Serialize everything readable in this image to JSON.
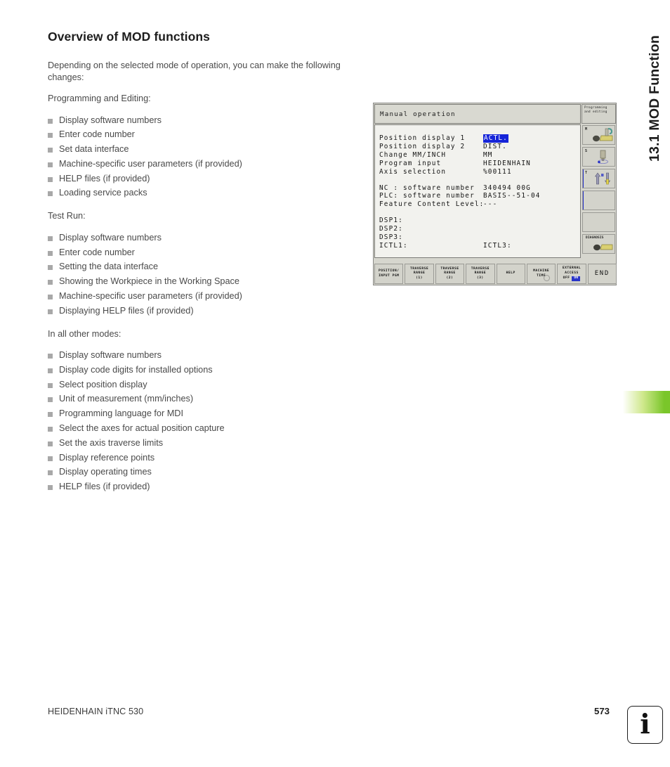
{
  "chapter_title": "13.1 MOD Function",
  "heading": "Overview of MOD functions",
  "intro": "Depending on the selected mode of operation, you can make the following changes:",
  "sections": [
    {
      "label": "Programming and Editing:",
      "items": [
        "Display software numbers",
        "Enter code number",
        "Set data interface",
        "Machine-specific user parameters (if provided)",
        "HELP files (if provided)",
        "Loading service packs"
      ]
    },
    {
      "label": "Test Run:",
      "items": [
        "Display software numbers",
        "Enter code number",
        "Setting the data interface",
        "Showing the Workpiece in the Working Space",
        "Machine-specific user parameters (if provided)",
        "Displaying HELP files (if provided)"
      ]
    },
    {
      "label": "In all other modes:",
      "items": [
        "Display software numbers",
        "Display code digits for installed options",
        "Select position display",
        "Unit of measurement (mm/inches)",
        "Programming language for MDI",
        "Select the axes for actual position capture",
        "Set the axis traverse limits",
        "Display reference points",
        "Display operating times",
        "HELP files (if provided)"
      ]
    }
  ],
  "cnc": {
    "mode_title": "Manual operation",
    "mode_box_line1": "Programming",
    "mode_box_line2": "and editing",
    "settings": [
      {
        "label": "Position display 1",
        "value": "ACTL.",
        "highlighted": true
      },
      {
        "label": "Position display 2",
        "value": "DIST.",
        "highlighted": false
      },
      {
        "label": "Change MM/INCH",
        "value": "MM",
        "highlighted": false
      },
      {
        "label": "Program input",
        "value": "HEIDENHAIN",
        "highlighted": false
      },
      {
        "label": "Axis selection",
        "value": "%00111",
        "highlighted": false
      }
    ],
    "versions": [
      {
        "label": "NC : software number",
        "value": "340494 00G"
      },
      {
        "label": "PLC: software number",
        "value": "BASIS--51-04"
      },
      {
        "label": "Feature Content Level:",
        "value": "---"
      }
    ],
    "diagnostics": [
      {
        "label": "DSP1:",
        "value": ""
      },
      {
        "label": "DSP2:",
        "value": ""
      },
      {
        "label": "DSP3:",
        "value": ""
      },
      {
        "label": "ICTL1:",
        "value": "ICTL3:"
      }
    ],
    "vertical_keys": [
      {
        "key": "M",
        "icon": "spindle-m-icon"
      },
      {
        "key": "S",
        "icon": "spindle-s-icon"
      },
      {
        "key": "T",
        "icon": "tool-change-icon"
      },
      {
        "key": "",
        "icon": ""
      },
      {
        "key": "",
        "icon": ""
      },
      {
        "key": "DIAGNOSIS",
        "icon": "diagnosis-icon"
      }
    ],
    "softkeys": [
      {
        "line1": "POSITION/",
        "line2": "INPUT PGM",
        "line3": ""
      },
      {
        "line1": "TRAVERSE",
        "line2": "RANGE",
        "line3": "(1)"
      },
      {
        "line1": "TRAVERSE",
        "line2": "RANGE",
        "line3": "(2)"
      },
      {
        "line1": "TRAVERSE",
        "line2": "RANGE",
        "line3": "(3)"
      },
      {
        "line1": "HELP",
        "line2": "",
        "line3": ""
      },
      {
        "line1": "MACHINE",
        "line2": "TIME",
        "line3": ""
      },
      {
        "line1": "EXTERNAL",
        "line2": "ACCESS",
        "line3": "OFF"
      },
      {
        "line1": "END",
        "line2": "",
        "line3": ""
      }
    ],
    "external_access_on_label": "ON",
    "accent_blue": "#2a35c8",
    "highlight_blue": "#1625d8"
  },
  "footer": {
    "product": "HEIDENHAIN iTNC 530",
    "page_number": "573",
    "info_glyph": "i"
  }
}
